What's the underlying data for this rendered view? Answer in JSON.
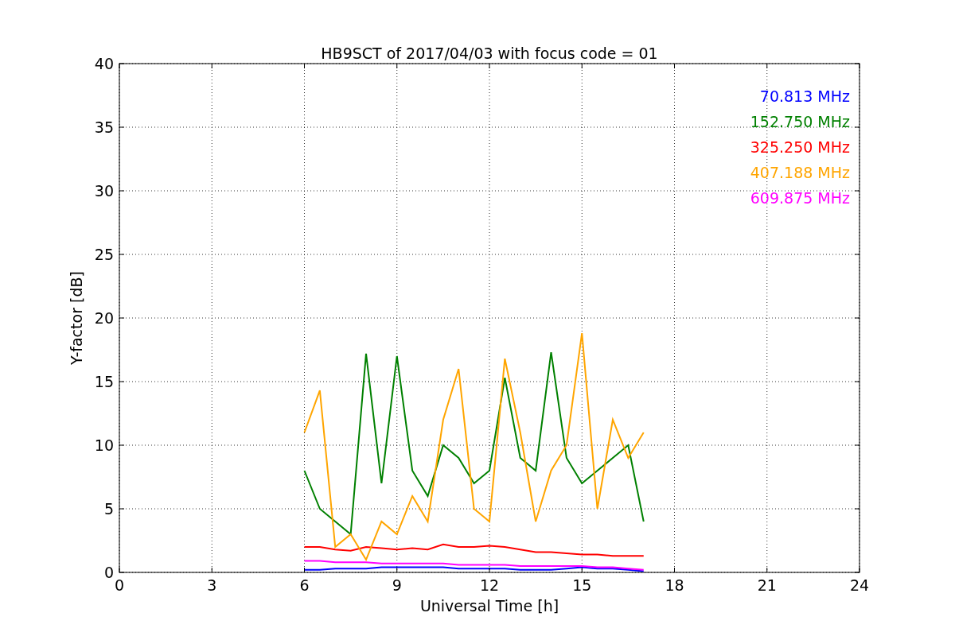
{
  "chart_data": {
    "type": "line",
    "title": "HB9SCT of 2017/04/03 with focus code = 01",
    "xlabel": "Universal Time [h]",
    "ylabel": "Y-factor [dB]",
    "x": [
      6,
      6.5,
      7,
      7.5,
      8,
      8.5,
      9,
      9.5,
      10,
      10.5,
      11,
      11.5,
      12,
      12.5,
      13,
      13.5,
      14,
      14.5,
      15,
      15.5,
      16,
      16.5,
      17
    ],
    "grid": true,
    "xlim": [
      0,
      24
    ],
    "ylim": [
      0,
      40
    ],
    "xticks": [
      0,
      3,
      6,
      9,
      12,
      15,
      18,
      21,
      24
    ],
    "yticks": [
      0,
      5,
      10,
      15,
      20,
      25,
      30,
      35,
      40
    ],
    "series": [
      {
        "name": "70.813 MHz",
        "color": "#0000ff",
        "values": [
          0.2,
          0.2,
          0.3,
          0.3,
          0.3,
          0.4,
          0.4,
          0.4,
          0.4,
          0.4,
          0.3,
          0.3,
          0.3,
          0.3,
          0.2,
          0.2,
          0.2,
          0.3,
          0.4,
          0.3,
          0.3,
          0.2,
          0.1
        ]
      },
      {
        "name": "152.750 MHz",
        "color": "#008000",
        "values": [
          8,
          5,
          4,
          3,
          17.2,
          7,
          17,
          8,
          6,
          10,
          9,
          7,
          8,
          15.3,
          9,
          8,
          17.3,
          9,
          7,
          8,
          9,
          10,
          4
        ]
      },
      {
        "name": "325.250 MHz",
        "color": "#ff0000",
        "values": [
          2,
          2,
          1.8,
          1.7,
          2,
          1.9,
          1.8,
          1.9,
          1.8,
          2.2,
          2,
          2,
          2.1,
          2,
          1.8,
          1.6,
          1.6,
          1.5,
          1.4,
          1.4,
          1.3,
          1.3,
          1.3
        ]
      },
      {
        "name": "407.188 MHz",
        "color": "#ffa500",
        "values": [
          11,
          14.3,
          2,
          3,
          1,
          4,
          3,
          6,
          4,
          12,
          16,
          5,
          4,
          16.8,
          11,
          4,
          8,
          10,
          18.8,
          5,
          12,
          9,
          11
        ]
      },
      {
        "name": "609.875 MHz",
        "color": "#ff00ff",
        "values": [
          0.9,
          0.9,
          0.8,
          0.8,
          0.8,
          0.7,
          0.7,
          0.7,
          0.7,
          0.7,
          0.6,
          0.6,
          0.6,
          0.6,
          0.5,
          0.5,
          0.5,
          0.5,
          0.5,
          0.4,
          0.4,
          0.3,
          0.2
        ]
      }
    ]
  }
}
